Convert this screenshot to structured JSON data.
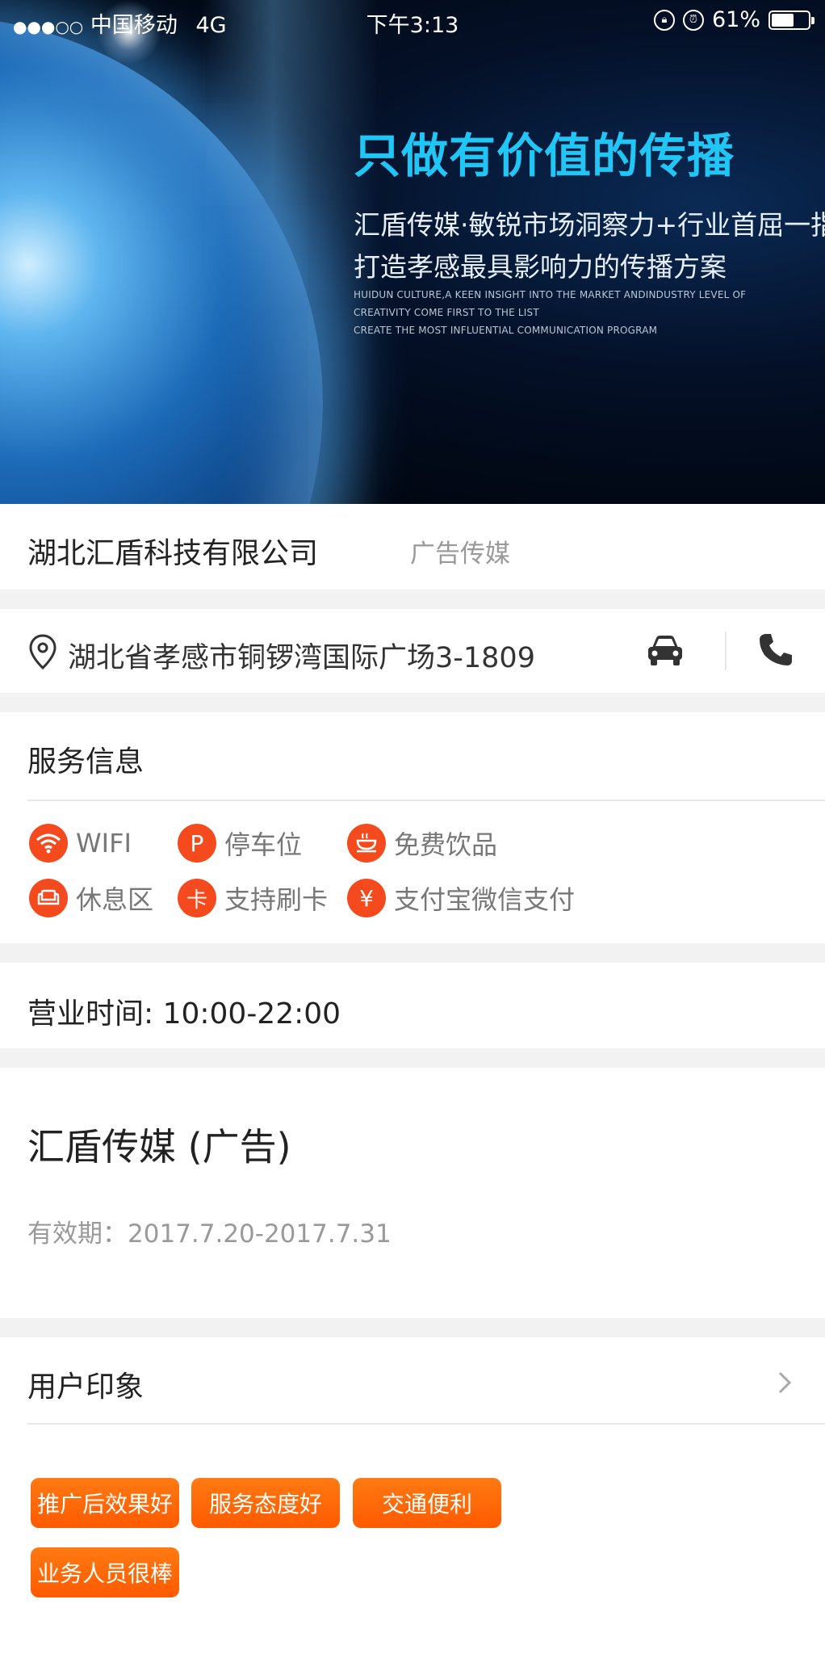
{
  "status_bar": {
    "signal": "●●●○○",
    "carrier": "中国移动",
    "network": "4G",
    "time": "下午3:13",
    "battery": "61%",
    "battery_level": 0.61
  },
  "banner": {
    "headline": "只做有价值的传播",
    "line1": "汇盾传媒·敏锐市场洞察力+行业首屈一指创意水平",
    "line2": "打造孝感最具影响力的传播方案",
    "en1": "HUIDUN CULTURE,A KEEN INSIGHT INTO THE MARKET ANDINDUSTRY LEVEL OF",
    "en2": "CREATIVITY COME FIRST TO THE LIST",
    "en3": "CREATE THE MOST INFLUENTIAL COMMUNICATION  PROGRAM"
  },
  "company": {
    "name": "湖北汇盾科技有限公司",
    "category": "广告传媒"
  },
  "address": {
    "text": "湖北省孝感市铜锣湾国际广场3-1809"
  },
  "service": {
    "title": "服务信息",
    "features": [
      {
        "icon": "wifi-icon",
        "glyph": "",
        "label": "WIFI"
      },
      {
        "icon": "parking-icon",
        "glyph": "P",
        "label": "停车位"
      },
      {
        "icon": "drink-icon",
        "glyph": "",
        "label": "免费饮品"
      },
      {
        "icon": "sofa-icon",
        "glyph": "",
        "label": "休息区"
      },
      {
        "icon": "card-icon",
        "glyph": "卡",
        "label": "支持刷卡"
      },
      {
        "icon": "yuan-icon",
        "glyph": "¥",
        "label": "支付宝微信支付"
      }
    ]
  },
  "hours": {
    "text": "营业时间: 10:00-22:00"
  },
  "deal": {
    "title": "汇盾传媒 (广告)",
    "validity": "有效期：2017.7.20-2017.7.31"
  },
  "impressions": {
    "title": "用户印象",
    "tags": [
      "推广后效果好",
      "服务态度好",
      "交通便利",
      "业务人员很棒"
    ]
  },
  "colors": {
    "accent": "#f44a1e",
    "tag": "#ff6a08",
    "banner_headline": "#20c6f5"
  }
}
